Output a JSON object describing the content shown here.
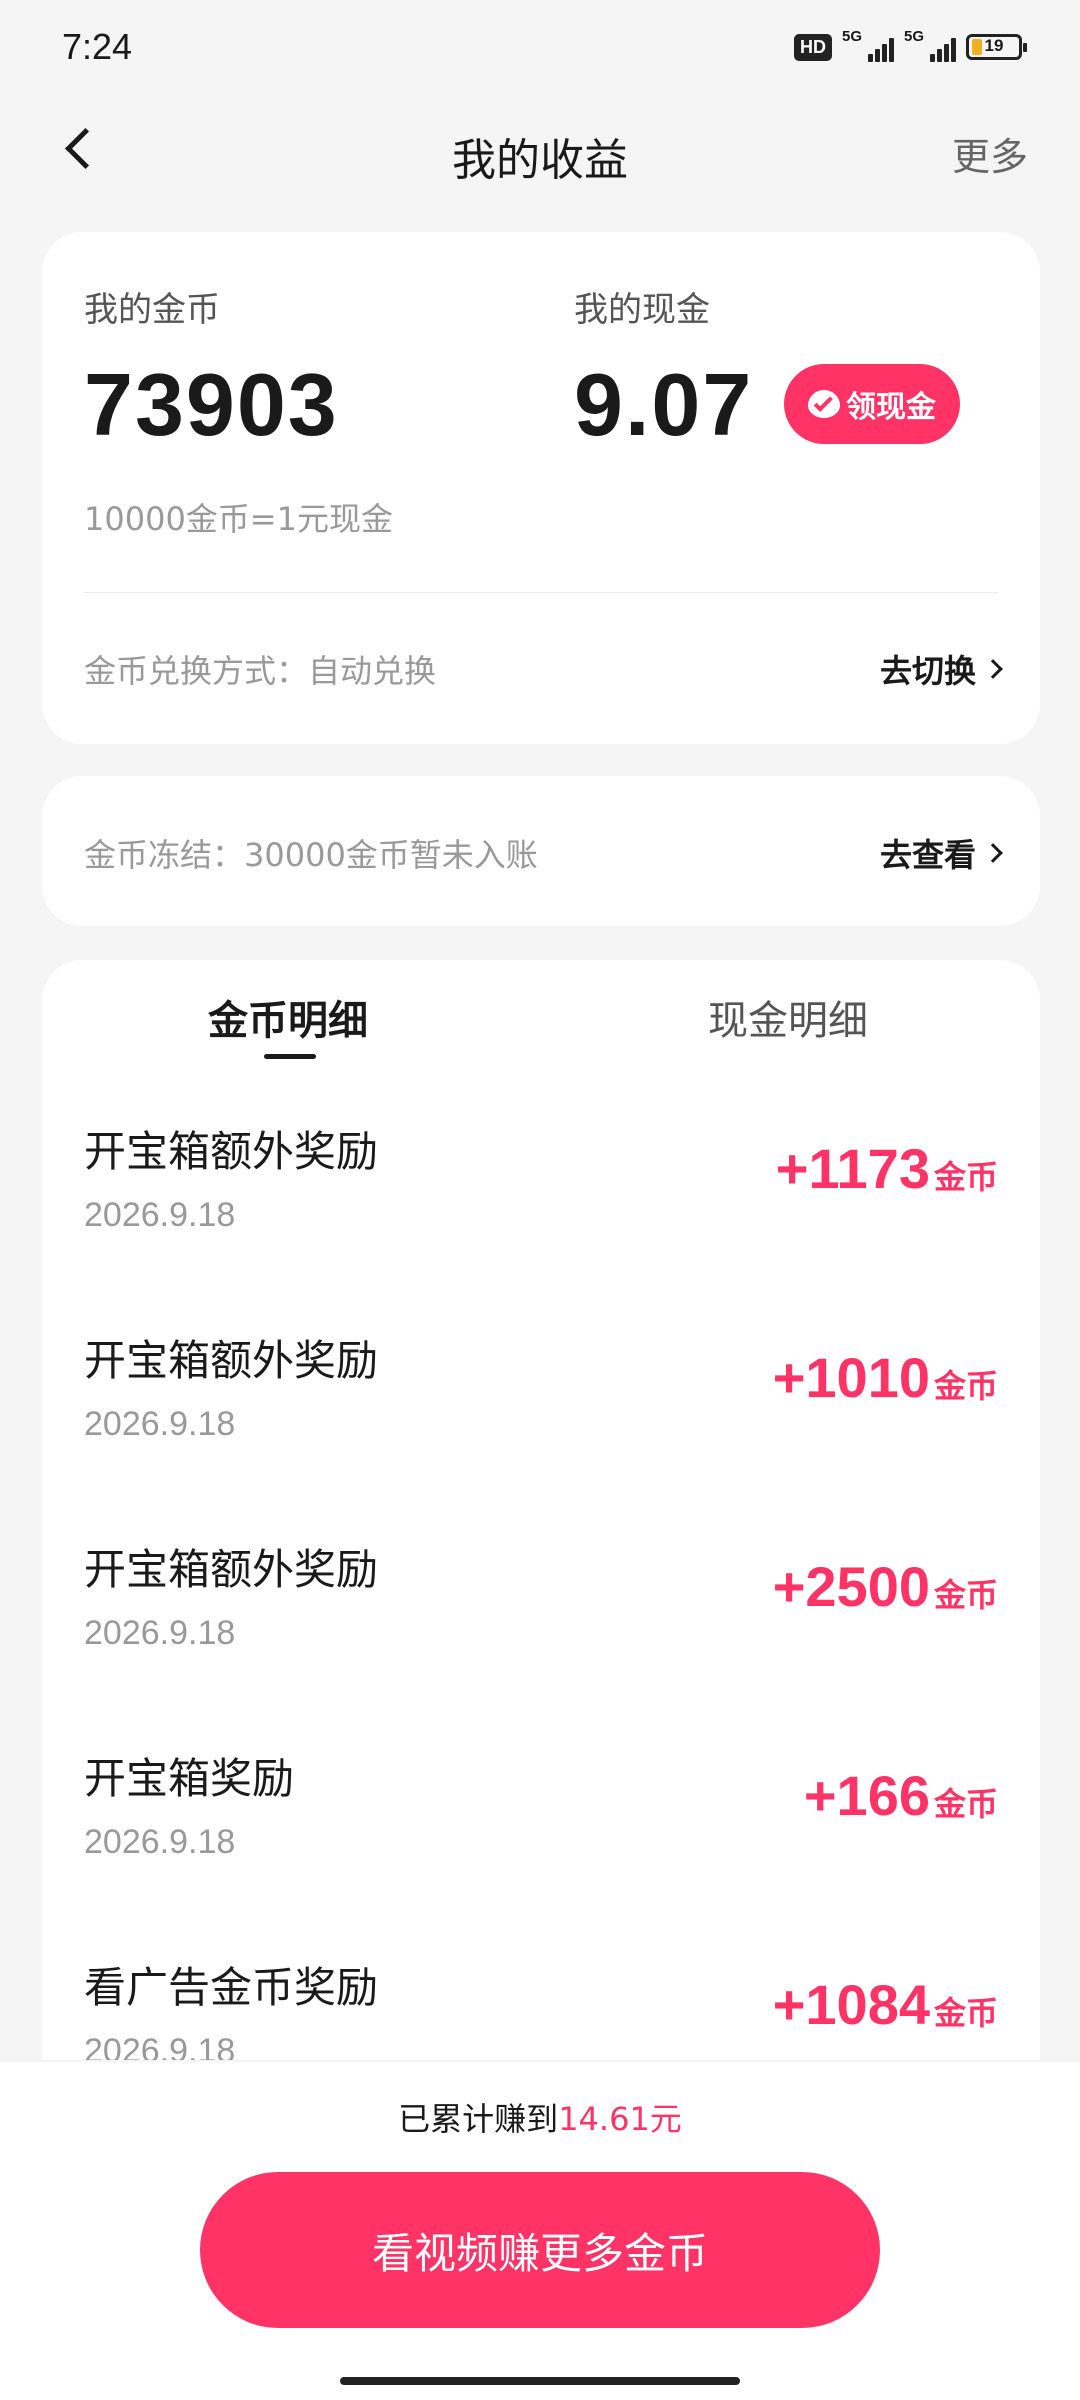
{
  "status_bar": {
    "time": "7:24",
    "hd": "HD",
    "net1": "5G",
    "net2": "5G",
    "battery": "19"
  },
  "nav": {
    "title": "我的收益",
    "more": "更多"
  },
  "wallet": {
    "coins_label": "我的金币",
    "coins_value": "73903",
    "cash_label": "我的现金",
    "cash_value": "9.07",
    "claim_button": "领现金",
    "rate": "10000金币=1元现金",
    "exchange_mode": "金币兑换方式：自动兑换",
    "switch_link": "去切换"
  },
  "frozen": {
    "text": "金币冻结：30000金币暂未入账",
    "link": "去查看"
  },
  "tabs": {
    "coins_detail": "金币明细",
    "cash_detail": "现金明细"
  },
  "records": [
    {
      "title": "开宝箱额外奖励",
      "date": "2026.9.18",
      "amount": "+1173",
      "unit": "金币"
    },
    {
      "title": "开宝箱额外奖励",
      "date": "2026.9.18",
      "amount": "+1010",
      "unit": "金币"
    },
    {
      "title": "开宝箱额外奖励",
      "date": "2026.9.18",
      "amount": "+2500",
      "unit": "金币"
    },
    {
      "title": "开宝箱奖励",
      "date": "2026.9.18",
      "amount": "+166",
      "unit": "金币"
    },
    {
      "title": "看广告金币奖励",
      "date": "2026.9.18",
      "amount": "+1084",
      "unit": "金币"
    }
  ],
  "footer": {
    "total_prefix": "已累计赚到",
    "total_value": "14.61元",
    "cta": "看视频赚更多金币"
  },
  "colors": {
    "accent": "#ff3366",
    "background": "#f5f5f5"
  }
}
